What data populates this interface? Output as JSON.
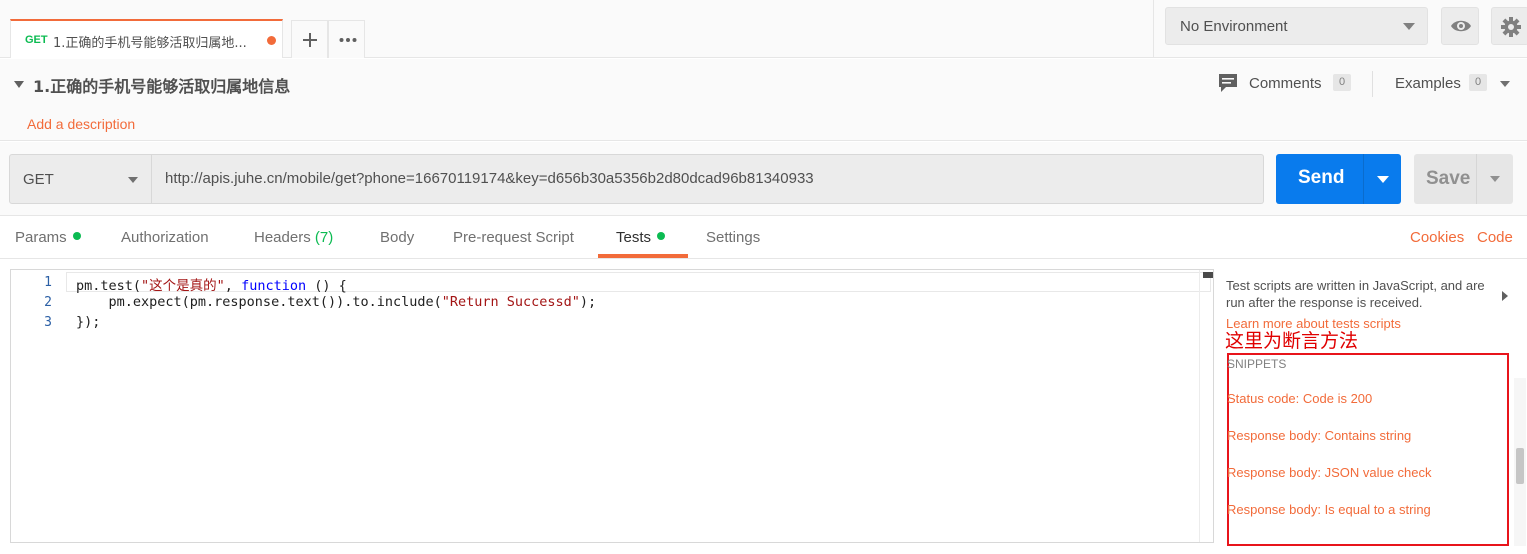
{
  "tabs": {
    "request_tab": {
      "method": "GET",
      "name": "1.正确的手机号能够活取归属地..."
    }
  },
  "environment": {
    "selected": "No Environment"
  },
  "request": {
    "title": "1.正确的手机号能够活取归属地信息",
    "add_description": "Add a description",
    "comments_label": "Comments",
    "comments_count": "0",
    "examples_label": "Examples",
    "examples_count": "0",
    "method": "GET",
    "url": "http://apis.juhe.cn/mobile/get?phone=16670119174&key=d656b30a5356b2d80dcad96b81340933",
    "send_label": "Send",
    "save_label": "Save"
  },
  "subtabs": {
    "params": "Params",
    "authorization": "Authorization",
    "headers": "Headers",
    "headers_count": "(7)",
    "body": "Body",
    "prerequest": "Pre-request Script",
    "tests": "Tests",
    "settings": "Settings",
    "cookies": "Cookies",
    "code": "Code"
  },
  "editor": {
    "line_numbers": [
      "1",
      "2",
      "3"
    ],
    "line1_a": "pm.test(",
    "line1_str": "\"这个是真的\"",
    "line1_b": ", ",
    "line1_kw": "function",
    "line1_c": " () {",
    "line2_a": "    pm.expect(pm.response.text()).to.include(",
    "line2_str": "\"Return Successd\"",
    "line2_b": ");",
    "line3": "});"
  },
  "snippets": {
    "info": "Test scripts are written in JavaScript, and are run after the response is received.",
    "learn_more": "Learn more about tests scripts",
    "annotation": "这里为断言方法",
    "heading": "SNIPPETS",
    "items": [
      "Status code: Code is 200",
      "Response body: Contains string",
      "Response body: JSON value check",
      "Response body: Is equal to a string"
    ]
  }
}
